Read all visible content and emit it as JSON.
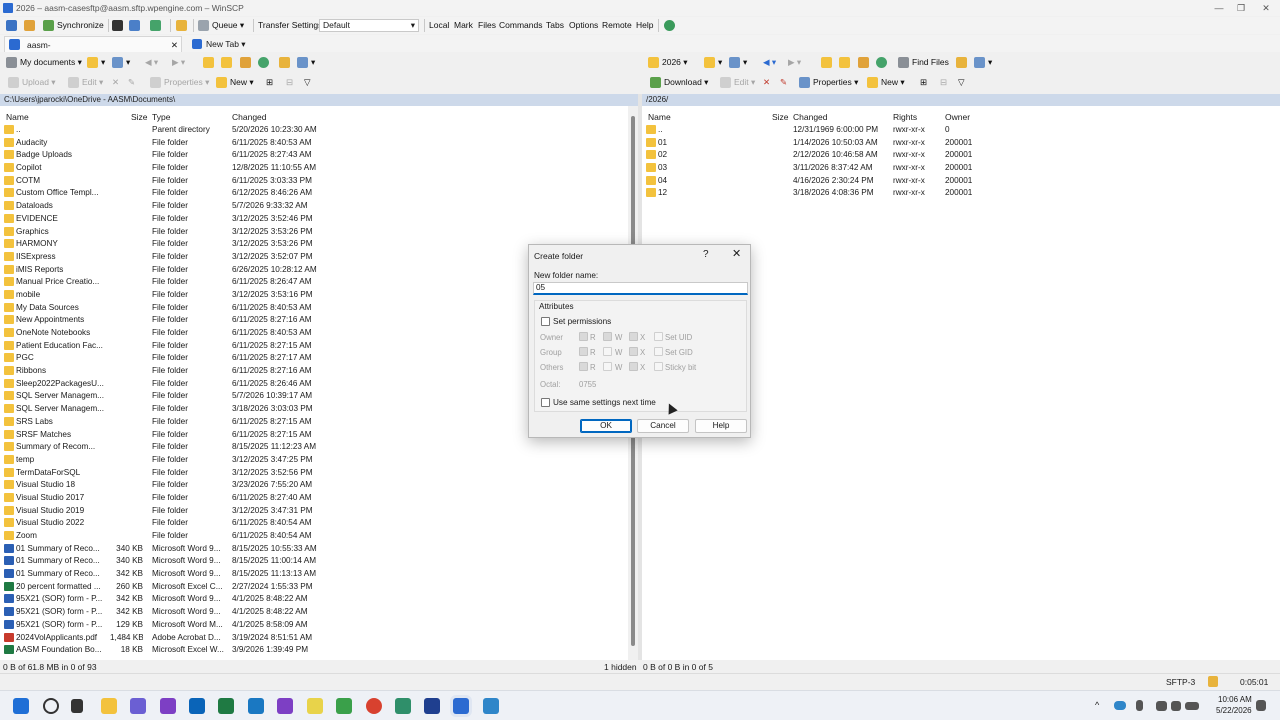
{
  "window": {
    "title": "2026 – aasm-casesftp@aasm.sftp.wpengine.com – WinSCP",
    "controls": [
      "—",
      "❐",
      "✕"
    ]
  },
  "toolbar": {
    "synchronize": "Synchronize",
    "queue": "Queue",
    "transfer_settings": "Transfer Settings",
    "transfer_value": "Default",
    "menus": [
      "Local",
      "Mark",
      "Files",
      "Commands",
      "Tabs",
      "Options",
      "Remote",
      "Help"
    ]
  },
  "tabs": {
    "active": "aasm-casesftp@aasm.sftp.wpengine.com",
    "close": "✕",
    "new_tab": "New Tab"
  },
  "left_panel": {
    "location": "My documents",
    "upload": "Upload",
    "edit": "Edit",
    "properties": "Properties",
    "new": "New",
    "path": "C:\\Users\\jparocki\\OneDrive - AASM\\Documents\\",
    "columns": [
      "Name",
      "Size",
      "Type",
      "Changed"
    ],
    "files": [
      {
        "name": "..",
        "size": "",
        "type": "Parent directory",
        "changed": "5/20/2026 10:23:30 AM",
        "kind": "parent"
      },
      {
        "name": "Audacity",
        "size": "",
        "type": "File folder",
        "changed": "6/11/2025 8:40:53 AM",
        "kind": "folder"
      },
      {
        "name": "Badge Uploads",
        "size": "",
        "type": "File folder",
        "changed": "6/11/2025 8:27:43 AM",
        "kind": "folder"
      },
      {
        "name": "Copilot",
        "size": "",
        "type": "File folder",
        "changed": "12/8/2025 11:10:55 AM",
        "kind": "folder"
      },
      {
        "name": "COTM",
        "size": "",
        "type": "File folder",
        "changed": "6/11/2025 3:03:33 PM",
        "kind": "folder"
      },
      {
        "name": "Custom Office Templ...",
        "size": "",
        "type": "File folder",
        "changed": "6/12/2025 8:46:26 AM",
        "kind": "folder"
      },
      {
        "name": "Dataloads",
        "size": "",
        "type": "File folder",
        "changed": "5/7/2026 9:33:32 AM",
        "kind": "folder"
      },
      {
        "name": "EVIDENCE",
        "size": "",
        "type": "File folder",
        "changed": "3/12/2025 3:52:46 PM",
        "kind": "folder"
      },
      {
        "name": "Graphics",
        "size": "",
        "type": "File folder",
        "changed": "3/12/2025 3:53:26 PM",
        "kind": "folder"
      },
      {
        "name": "HARMONY",
        "size": "",
        "type": "File folder",
        "changed": "3/12/2025 3:53:26 PM",
        "kind": "folder"
      },
      {
        "name": "IISExpress",
        "size": "",
        "type": "File folder",
        "changed": "3/12/2025 3:52:07 PM",
        "kind": "folder"
      },
      {
        "name": "iMIS Reports",
        "size": "",
        "type": "File folder",
        "changed": "6/26/2025 10:28:12 AM",
        "kind": "folder"
      },
      {
        "name": "Manual Price Creatio...",
        "size": "",
        "type": "File folder",
        "changed": "6/11/2025 8:26:47 AM",
        "kind": "folder"
      },
      {
        "name": "mobile",
        "size": "",
        "type": "File folder",
        "changed": "3/12/2025 3:53:16 PM",
        "kind": "folder"
      },
      {
        "name": "My Data Sources",
        "size": "",
        "type": "File folder",
        "changed": "6/11/2025 8:40:53 AM",
        "kind": "folder"
      },
      {
        "name": "New Appointments",
        "size": "",
        "type": "File folder",
        "changed": "6/11/2025 8:27:16 AM",
        "kind": "folder"
      },
      {
        "name": "OneNote Notebooks",
        "size": "",
        "type": "File folder",
        "changed": "6/11/2025 8:40:53 AM",
        "kind": "folder"
      },
      {
        "name": "Patient Education Fac...",
        "size": "",
        "type": "File folder",
        "changed": "6/11/2025 8:27:15 AM",
        "kind": "folder"
      },
      {
        "name": "PGC",
        "size": "",
        "type": "File folder",
        "changed": "6/11/2025 8:27:17 AM",
        "kind": "folder"
      },
      {
        "name": "Ribbons",
        "size": "",
        "type": "File folder",
        "changed": "6/11/2025 8:27:16 AM",
        "kind": "folder"
      },
      {
        "name": "Sleep2022PackagesU...",
        "size": "",
        "type": "File folder",
        "changed": "6/11/2025 8:26:46 AM",
        "kind": "folder"
      },
      {
        "name": "SQL Server Managem...",
        "size": "",
        "type": "File folder",
        "changed": "5/7/2026 10:39:17 AM",
        "kind": "folder"
      },
      {
        "name": "SQL Server Managem...",
        "size": "",
        "type": "File folder",
        "changed": "3/18/2026 3:03:03 PM",
        "kind": "folder"
      },
      {
        "name": "SRS Labs",
        "size": "",
        "type": "File folder",
        "changed": "6/11/2025 8:27:15 AM",
        "kind": "folder"
      },
      {
        "name": "SRSF Matches",
        "size": "",
        "type": "File folder",
        "changed": "6/11/2025 8:27:15 AM",
        "kind": "folder"
      },
      {
        "name": "Summary of Recom...",
        "size": "",
        "type": "File folder",
        "changed": "8/15/2025 11:12:23 AM",
        "kind": "folder"
      },
      {
        "name": "temp",
        "size": "",
        "type": "File folder",
        "changed": "3/12/2025 3:47:25 PM",
        "kind": "folder"
      },
      {
        "name": "TermDataForSQL",
        "size": "",
        "type": "File folder",
        "changed": "3/12/2025 3:52:56 PM",
        "kind": "folder"
      },
      {
        "name": "Visual Studio 18",
        "size": "",
        "type": "File folder",
        "changed": "3/23/2026 7:55:20 AM",
        "kind": "folder"
      },
      {
        "name": "Visual Studio 2017",
        "size": "",
        "type": "File folder",
        "changed": "6/11/2025 8:27:40 AM",
        "kind": "folder"
      },
      {
        "name": "Visual Studio 2019",
        "size": "",
        "type": "File folder",
        "changed": "3/12/2025 3:47:31 PM",
        "kind": "folder"
      },
      {
        "name": "Visual Studio 2022",
        "size": "",
        "type": "File folder",
        "changed": "6/11/2025 8:40:54 AM",
        "kind": "folder"
      },
      {
        "name": "Zoom",
        "size": "",
        "type": "File folder",
        "changed": "6/11/2025 8:40:54 AM",
        "kind": "folder"
      },
      {
        "name": "01 Summary of Reco...",
        "size": "340 KB",
        "type": "Microsoft Word 9...",
        "changed": "8/15/2025 10:55:33 AM",
        "kind": "word"
      },
      {
        "name": "01 Summary of Reco...",
        "size": "340 KB",
        "type": "Microsoft Word 9...",
        "changed": "8/15/2025 11:00:14 AM",
        "kind": "word"
      },
      {
        "name": "01 Summary of Reco...",
        "size": "342 KB",
        "type": "Microsoft Word 9...",
        "changed": "8/15/2025 11:13:13 AM",
        "kind": "word"
      },
      {
        "name": "20 percent formatted ...",
        "size": "260 KB",
        "type": "Microsoft Excel C...",
        "changed": "2/27/2024 1:55:33 PM",
        "kind": "excel"
      },
      {
        "name": "95X21 (SOR) form - P...",
        "size": "342 KB",
        "type": "Microsoft Word 9...",
        "changed": "4/1/2025 8:48:22 AM",
        "kind": "word"
      },
      {
        "name": "95X21 (SOR) form - P...",
        "size": "342 KB",
        "type": "Microsoft Word 9...",
        "changed": "4/1/2025 8:48:22 AM",
        "kind": "word"
      },
      {
        "name": "95X21 (SOR) form - P...",
        "size": "129 KB",
        "type": "Microsoft Word M...",
        "changed": "4/1/2025 8:58:09 AM",
        "kind": "word"
      },
      {
        "name": "2024VolApplicants.pdf",
        "size": "1,484 KB",
        "type": "Adobe Acrobat D...",
        "changed": "3/19/2024 8:51:51 AM",
        "kind": "pdf"
      },
      {
        "name": "AASM Foundation Bo...",
        "size": "18 KB",
        "type": "Microsoft Excel W...",
        "changed": "3/9/2026 1:39:49 PM",
        "kind": "excel"
      }
    ],
    "status": "0 B of 61.8 MB in 0 of 93",
    "hidden": "1 hidden"
  },
  "right_panel": {
    "location": "2026",
    "download": "Download",
    "edit": "Edit",
    "properties": "Properties",
    "new": "New",
    "find_files": "Find Files",
    "path": "/2026/",
    "columns": [
      "Name",
      "Size",
      "Changed",
      "Rights",
      "Owner"
    ],
    "files": [
      {
        "name": "..",
        "changed": "12/31/1969 6:00:00 PM",
        "rights": "rwxr-xr-x",
        "owner": "0"
      },
      {
        "name": "01",
        "changed": "1/14/2026 10:50:03 AM",
        "rights": "rwxr-xr-x",
        "owner": "200001"
      },
      {
        "name": "02",
        "changed": "2/12/2026 10:46:58 AM",
        "rights": "rwxr-xr-x",
        "owner": "200001"
      },
      {
        "name": "03",
        "changed": "3/11/2026 8:37:42 AM",
        "rights": "rwxr-xr-x",
        "owner": "200001"
      },
      {
        "name": "04",
        "changed": "4/16/2026 2:30:24 PM",
        "rights": "rwxr-xr-x",
        "owner": "200001"
      },
      {
        "name": "12",
        "changed": "3/18/2026 4:08:36 PM",
        "rights": "rwxr-xr-x",
        "owner": "200001"
      }
    ],
    "status": "0 B of 0 B in 0 of 5"
  },
  "statusbar": {
    "protocol": "SFTP-3",
    "time": "0:05:01"
  },
  "dialog": {
    "title": "Create folder",
    "help_glyph": "?",
    "close_glyph": "✕",
    "label": "New folder name:",
    "value": "05",
    "attributes_label": "Attributes",
    "set_permissions": "Set permissions",
    "rows": [
      "Owner",
      "Group",
      "Others"
    ],
    "perm_letters": [
      "R",
      "W",
      "X"
    ],
    "special": [
      "Set UID",
      "Set GID",
      "Sticky bit"
    ],
    "octal_label": "Octal:",
    "octal_value": "0755",
    "use_same": "Use same settings next time",
    "ok": "OK",
    "cancel": "Cancel",
    "help": "Help"
  },
  "taskbar": {
    "clock_time": "10:06 AM",
    "clock_date": "5/22/2026",
    "tray_chevron": "^"
  }
}
